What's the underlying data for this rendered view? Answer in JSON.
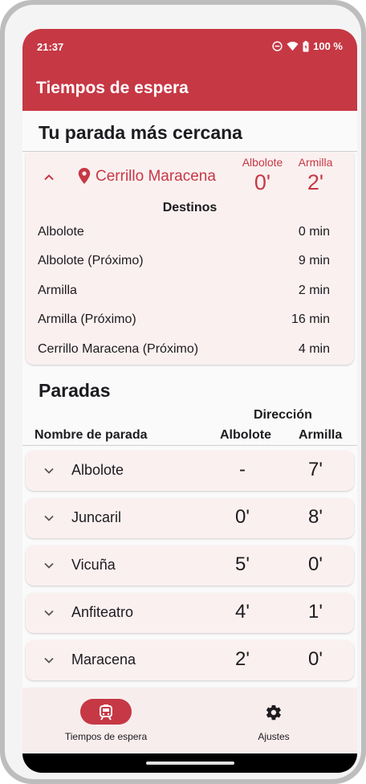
{
  "status_bar": {
    "time": "21:37",
    "battery": "100 %",
    "icons": [
      "do-not-disturb-icon",
      "wifi-icon",
      "battery-icon"
    ]
  },
  "app_bar": {
    "title": "Tiempos de espera"
  },
  "nearest": {
    "section_title": "Tu parada más cercana",
    "stop_name": "Cerrillo Maracena",
    "directions": [
      {
        "label": "Albolote",
        "value": "0'"
      },
      {
        "label": "Armilla",
        "value": "2'"
      }
    ],
    "destinations_title": "Destinos",
    "destinations": [
      {
        "name": "Albolote",
        "time": "0 min"
      },
      {
        "name": "Albolote (Próximo)",
        "time": "9 min"
      },
      {
        "name": "Armilla",
        "time": "2 min"
      },
      {
        "name": "Armilla (Próximo)",
        "time": "16 min"
      },
      {
        "name": "Cerrillo Maracena (Próximo)",
        "time": "4 min"
      }
    ]
  },
  "stops": {
    "section_title": "Paradas",
    "direction_header": "Dirección",
    "col_name": "Nombre de parada",
    "col_albolote": "Albolote",
    "col_armilla": "Armilla",
    "rows": [
      {
        "name": "Albolote",
        "albolote": "-",
        "armilla": "7'"
      },
      {
        "name": "Juncaril",
        "albolote": "0'",
        "armilla": "8'"
      },
      {
        "name": "Vicuña",
        "albolote": "5'",
        "armilla": "0'"
      },
      {
        "name": "Anfiteatro",
        "albolote": "4'",
        "armilla": "1'"
      },
      {
        "name": "Maracena",
        "albolote": "2'",
        "armilla": "0'"
      }
    ]
  },
  "bottom_nav": {
    "items": [
      {
        "label": "Tiempos de espera",
        "icon": "tram-icon",
        "active": true
      },
      {
        "label": "Ajustes",
        "icon": "gear-icon",
        "active": false
      }
    ]
  },
  "colors": {
    "accent": "#c63844",
    "card": "#fbf0f0",
    "nav_bg": "#f8eded"
  }
}
